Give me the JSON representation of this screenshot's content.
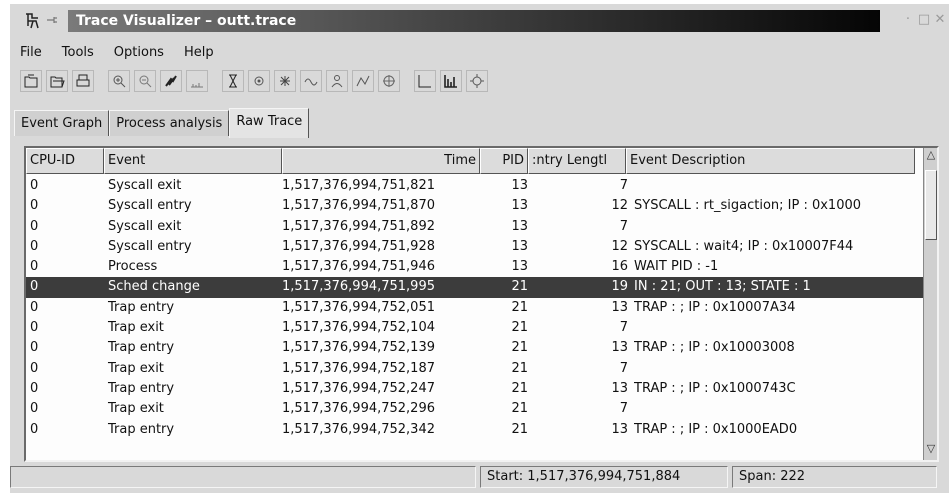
{
  "window": {
    "title": "Trace Visualizer – outt.trace"
  },
  "menubar": {
    "items": [
      "File",
      "Tools",
      "Options",
      "Help"
    ]
  },
  "toolbar": {
    "buttons": [
      "open-file-icon",
      "open-folder-icon",
      "print-icon",
      "zoom-in-icon",
      "zoom-out-icon",
      "tool-icon",
      "histogram-icon",
      "hourglass-icon",
      "gear-icon",
      "gear-alt-icon",
      "wave-icon",
      "person-icon",
      "process-icon",
      "gear-alt2-icon",
      "bar-chart-icon",
      "bar-chart-alt-icon",
      "settings-icon"
    ]
  },
  "tabs": [
    {
      "label": "Event Graph",
      "active": false
    },
    {
      "label": "Process analysis",
      "active": false
    },
    {
      "label": "Raw Trace",
      "active": true
    }
  ],
  "table": {
    "columns": [
      "CPU-ID",
      "Event",
      "Time",
      "PID",
      "Entry Length",
      "Event Description"
    ],
    "header_visible": {
      "cpu": "CPU-ID",
      "event": "Event",
      "time": "Time",
      "pid": "PID",
      "length": ":ntry Lengtl",
      "desc": "Event Description"
    },
    "rows": [
      {
        "cpu": "0",
        "event": "Syscall exit",
        "time": "1,517,376,994,751,821",
        "pid": "13",
        "length": "7",
        "desc": ""
      },
      {
        "cpu": "0",
        "event": "Syscall entry",
        "time": "1,517,376,994,751,870",
        "pid": "13",
        "length": "12",
        "desc": "SYSCALL : rt_sigaction; IP : 0x1000"
      },
      {
        "cpu": "0",
        "event": "Syscall exit",
        "time": "1,517,376,994,751,892",
        "pid": "13",
        "length": "7",
        "desc": ""
      },
      {
        "cpu": "0",
        "event": "Syscall entry",
        "time": "1,517,376,994,751,928",
        "pid": "13",
        "length": "12",
        "desc": "SYSCALL : wait4; IP : 0x10007F44"
      },
      {
        "cpu": "0",
        "event": "Process",
        "time": "1,517,376,994,751,946",
        "pid": "13",
        "length": "16",
        "desc": "WAIT PID : -1"
      },
      {
        "cpu": "0",
        "event": "Sched change",
        "time": "1,517,376,994,751,995",
        "pid": "21",
        "length": "19",
        "desc": "IN : 21; OUT : 13; STATE : 1",
        "selected": true
      },
      {
        "cpu": "0",
        "event": "Trap entry",
        "time": "1,517,376,994,752,051",
        "pid": "21",
        "length": "13",
        "desc": "TRAP : ; IP : 0x10007A34"
      },
      {
        "cpu": "0",
        "event": "Trap exit",
        "time": "1,517,376,994,752,104",
        "pid": "21",
        "length": "7",
        "desc": ""
      },
      {
        "cpu": "0",
        "event": "Trap entry",
        "time": "1,517,376,994,752,139",
        "pid": "21",
        "length": "13",
        "desc": "TRAP : ; IP : 0x10003008"
      },
      {
        "cpu": "0",
        "event": "Trap exit",
        "time": "1,517,376,994,752,187",
        "pid": "21",
        "length": "7",
        "desc": ""
      },
      {
        "cpu": "0",
        "event": "Trap entry",
        "time": "1,517,376,994,752,247",
        "pid": "21",
        "length": "13",
        "desc": "TRAP : ; IP : 0x1000743C"
      },
      {
        "cpu": "0",
        "event": "Trap exit",
        "time": "1,517,376,994,752,296",
        "pid": "21",
        "length": "7",
        "desc": ""
      },
      {
        "cpu": "0",
        "event": "Trap entry",
        "time": "1,517,376,994,752,342",
        "pid": "21",
        "length": "13",
        "desc": "TRAP : ; IP : 0x1000EAD0"
      }
    ]
  },
  "statusbar": {
    "message": "",
    "start": "Start: 1,517,376,994,751,884",
    "span": "Span: 222"
  },
  "colors": {
    "selection": "#3c3c3c",
    "window_bg": "#d9d9d9",
    "title_gradient_end": "#050505"
  }
}
